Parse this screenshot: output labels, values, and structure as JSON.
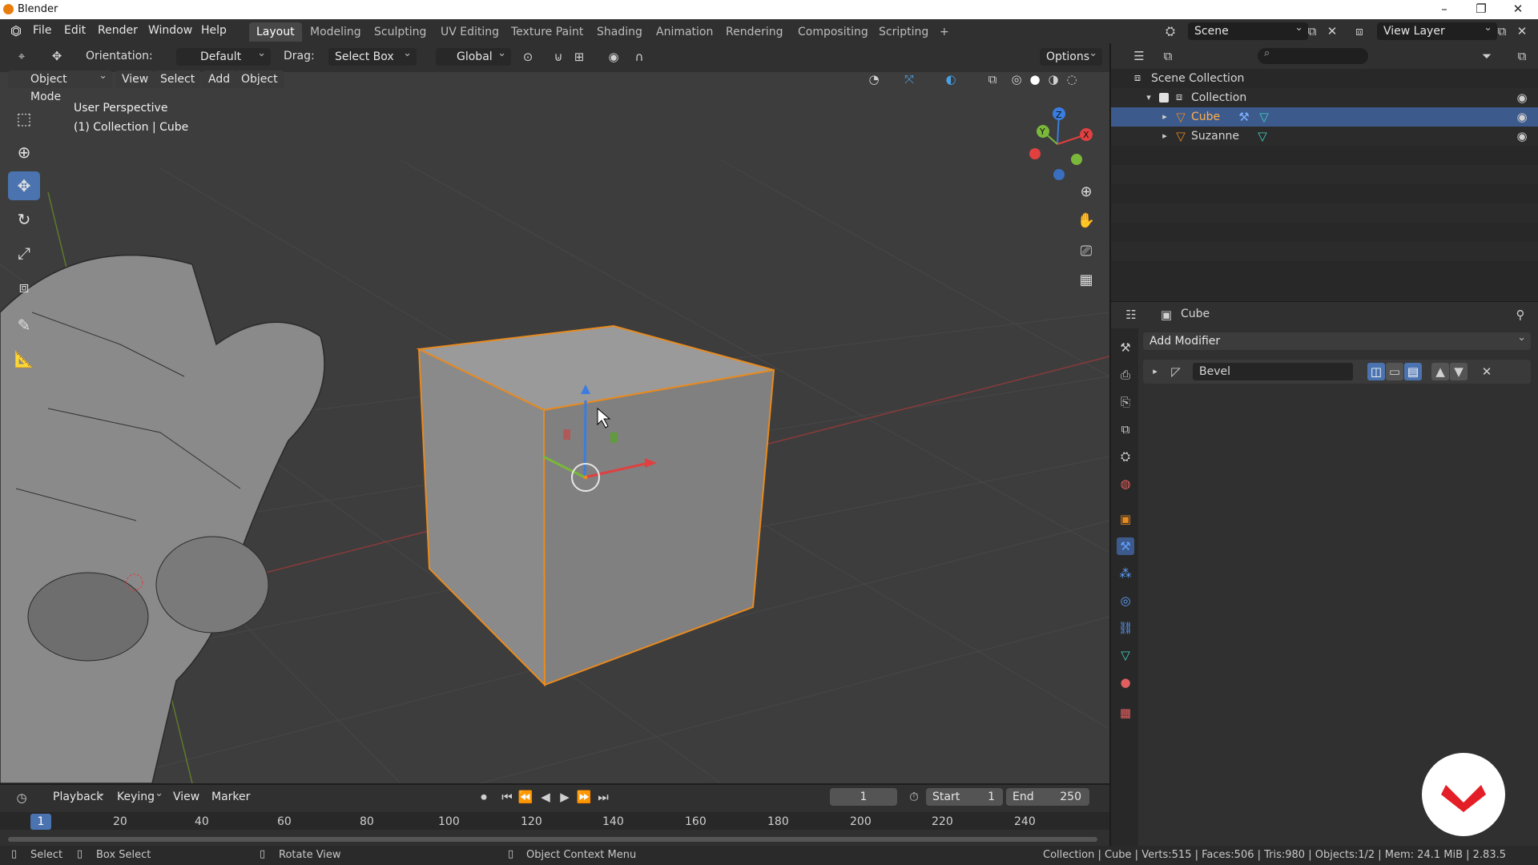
{
  "window": {
    "title": "Blender",
    "minimize": "–",
    "maximize": "❐",
    "close": "✕"
  },
  "menu": [
    "File",
    "Edit",
    "Render",
    "Window",
    "Help"
  ],
  "workspaces": [
    "Layout",
    "Modeling",
    "Sculpting",
    "UV Editing",
    "Texture Paint",
    "Shading",
    "Animation",
    "Rendering",
    "Compositing",
    "Scripting"
  ],
  "workspace_add": "+",
  "scene": {
    "name": "Scene",
    "view_layer": "View Layer"
  },
  "viewport_header": {
    "orientation_label": "Orientation:",
    "orientation_value": "Default",
    "drag_label": "Drag:",
    "drag_value": "Select Box",
    "transform_space": "Global",
    "options": "Options",
    "mode": "Object Mode",
    "menus": [
      "View",
      "Select",
      "Add",
      "Object"
    ]
  },
  "viewport": {
    "perspective": "User Perspective",
    "context": "(1) Collection | Cube",
    "gizmo_axes": {
      "x": "X",
      "y": "Y",
      "z": "Z"
    }
  },
  "tools": [
    "select-box-tool-icon",
    "cursor-tool-icon",
    "move-tool-icon",
    "rotate-tool-icon",
    "scale-tool-icon",
    "transform-tool-icon",
    "annotate-tool-icon",
    "measure-tool-icon"
  ],
  "outliner": {
    "root": "Scene Collection",
    "collection": "Collection",
    "items": [
      {
        "name": "Cube",
        "selected": true
      },
      {
        "name": "Suzanne",
        "selected": false
      }
    ]
  },
  "properties": {
    "object_name": "Cube",
    "add_modifier": "Add Modifier",
    "modifier_name": "Bevel",
    "modifier_close": "✕"
  },
  "timeline": {
    "menus": [
      "Playback",
      "Keying",
      "View",
      "Marker"
    ],
    "current_frame": "1",
    "start_label": "Start",
    "start_value": "1",
    "end_label": "End",
    "end_value": "250",
    "ruler_current": "1",
    "ruler": [
      "20",
      "40",
      "60",
      "80",
      "100",
      "120",
      "140",
      "160",
      "180",
      "200",
      "220",
      "240"
    ]
  },
  "statusbar": {
    "left_click": "Select",
    "drag": "Box Select",
    "middle": "Rotate View",
    "right": "Object Context Menu",
    "info": "Collection | Cube | Verts:515 | Faces:506 | Tris:980 | Objects:1/2 | Mem: 24.1 MiB | 2.83.5"
  },
  "colors": {
    "accent": "#4a73b0",
    "selection": "#e88a1f",
    "header": "#303030",
    "viewport": "#3d3d3d"
  }
}
